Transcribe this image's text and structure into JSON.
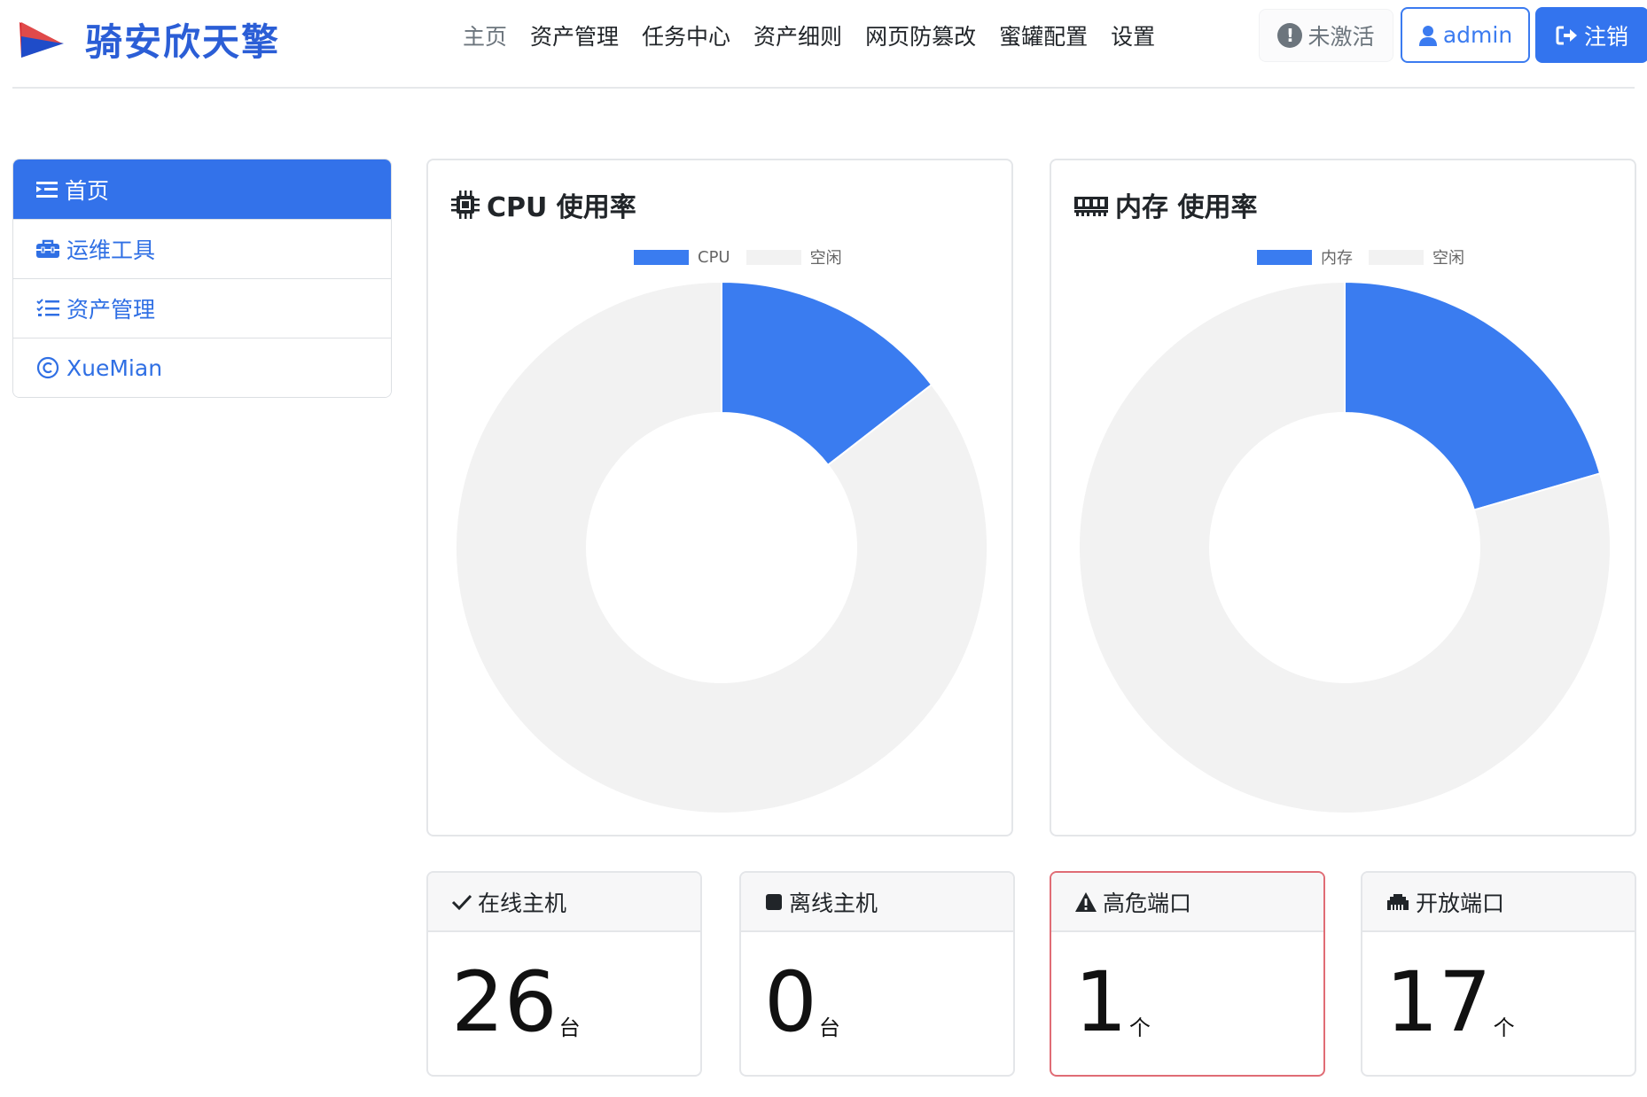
{
  "app": {
    "title": "骑安欣天擎"
  },
  "nav": {
    "items": [
      {
        "label": "主页",
        "active": true
      },
      {
        "label": "资产管理"
      },
      {
        "label": "任务中心"
      },
      {
        "label": "资产细则"
      },
      {
        "label": "网页防篡改"
      },
      {
        "label": "蜜罐配置"
      },
      {
        "label": "设置"
      }
    ]
  },
  "header": {
    "status_label": "未激活",
    "status_icon": "exclamation-circle-icon",
    "user_label": "admin",
    "user_icon": "user-icon",
    "logout_label": "注销",
    "logout_icon": "sign-out-icon"
  },
  "sidebar": {
    "items": [
      {
        "label": "首页",
        "icon": "indent-list-icon",
        "active": true
      },
      {
        "label": "运维工具",
        "icon": "toolbox-icon"
      },
      {
        "label": "资产管理",
        "icon": "task-list-icon"
      },
      {
        "label": "XueMian",
        "icon": "copyright-icon"
      }
    ]
  },
  "colors": {
    "accent": "#3374ee",
    "used": "#3a7cf0",
    "idle": "#f2f2f2",
    "danger_border": "#e06c75"
  },
  "charts": {
    "cpu_title": "CPU 使用率",
    "mem_title": "内存 使用率"
  },
  "chart_data": [
    {
      "type": "pie",
      "title": "CPU 使用率",
      "categories": [
        "CPU",
        "空闲"
      ],
      "values": [
        14.5,
        85.5
      ],
      "colors": [
        "#3a7cf0",
        "#f2f2f2"
      ],
      "legend": "top-center"
    },
    {
      "type": "pie",
      "title": "内存 使用率",
      "categories": [
        "内存",
        "空闲"
      ],
      "values": [
        20.5,
        79.5
      ],
      "colors": [
        "#3a7cf0",
        "#f2f2f2"
      ],
      "legend": "top-center"
    }
  ],
  "stats": [
    {
      "label": "在线主机",
      "value": "26",
      "unit": "台",
      "icon": "check-icon"
    },
    {
      "label": "离线主机",
      "value": "0",
      "unit": "台",
      "icon": "stop-square-icon"
    },
    {
      "label": "高危端口",
      "value": "1",
      "unit": "个",
      "icon": "warning-triangle-icon"
    },
    {
      "label": "开放端口",
      "value": "17",
      "unit": "个",
      "icon": "ethernet-port-icon"
    }
  ]
}
